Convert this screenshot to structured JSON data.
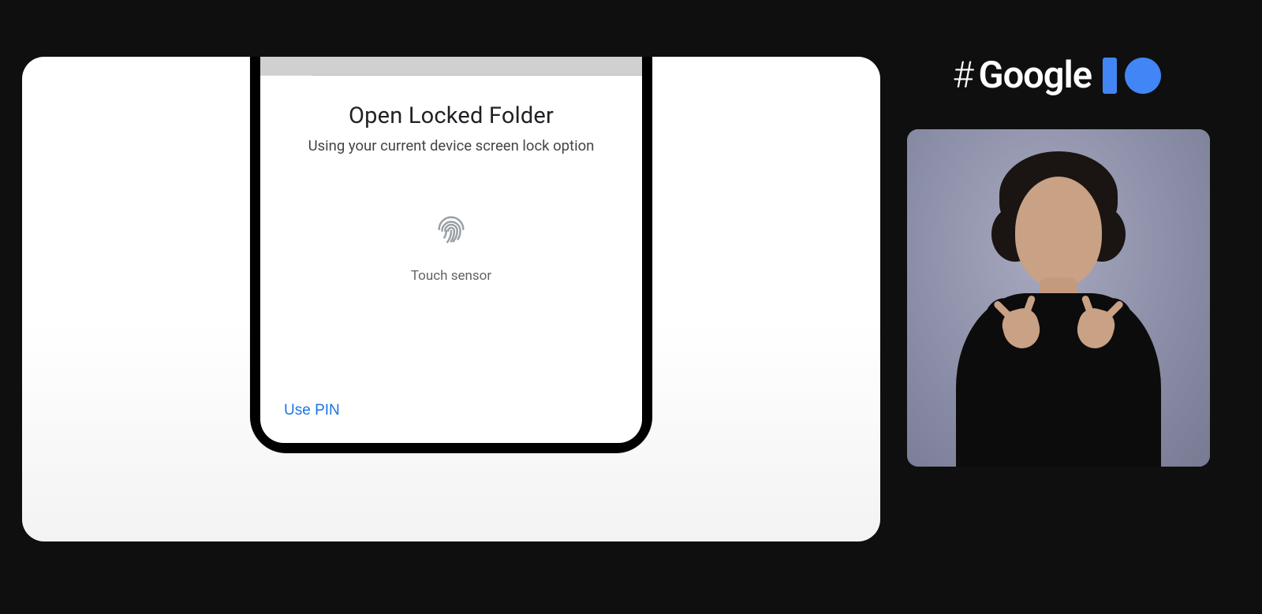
{
  "event_logo": {
    "hashtag": "#",
    "brand": "Google"
  },
  "phone_dialog": {
    "title": "Open Locked Folder",
    "subtitle": "Using your current device screen lock option",
    "sensor_label": "Touch sensor",
    "use_pin_label": "Use PIN"
  }
}
